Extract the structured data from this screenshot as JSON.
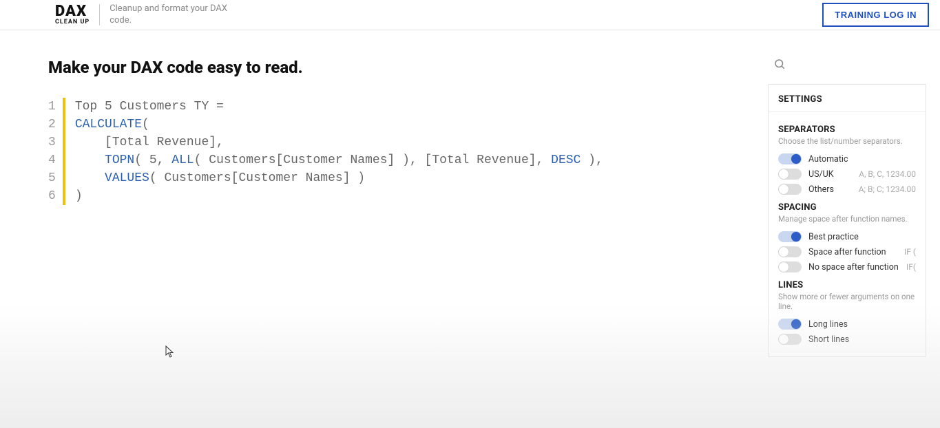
{
  "header": {
    "logo_main": "DAX",
    "logo_sub": "CLEAN UP",
    "tagline": "Cleanup and format your DAX code.",
    "login_label": "TRAINING LOG IN"
  },
  "page": {
    "heading": "Make your DAX code easy to read."
  },
  "code": {
    "line_numbers": [
      "1",
      "2",
      "3",
      "4",
      "5",
      "6"
    ],
    "lines": [
      [
        {
          "t": "Top 5 Customers TY ="
        }
      ],
      [
        {
          "t": "CALCULATE",
          "kw": true
        },
        {
          "t": "("
        }
      ],
      [
        {
          "t": "    [Total Revenue],"
        }
      ],
      [
        {
          "t": "    "
        },
        {
          "t": "TOPN",
          "kw": true
        },
        {
          "t": "( 5, "
        },
        {
          "t": "ALL",
          "kw": true
        },
        {
          "t": "( Customers[Customer Names] ), [Total Revenue], "
        },
        {
          "t": "DESC",
          "kw": true
        },
        {
          "t": " ),"
        }
      ],
      [
        {
          "t": "    "
        },
        {
          "t": "VALUES",
          "kw": true
        },
        {
          "t": "( Customers[Customer Names] )"
        }
      ],
      [
        {
          "t": ")"
        }
      ]
    ]
  },
  "settings": {
    "panel_title": "SETTINGS",
    "separators": {
      "title": "SEPARATORS",
      "desc": "Choose the list/number separators.",
      "options": [
        {
          "label": "Automatic",
          "on": true,
          "hint": ""
        },
        {
          "label": "US/UK",
          "on": false,
          "hint": "A, B, C, 1234.00"
        },
        {
          "label": "Others",
          "on": false,
          "hint": "A; B; C; 1234.00"
        }
      ]
    },
    "spacing": {
      "title": "SPACING",
      "desc": "Manage space after function names.",
      "options": [
        {
          "label": "Best practice",
          "on": true,
          "hint": ""
        },
        {
          "label": "Space after function",
          "on": false,
          "hint": "IF ("
        },
        {
          "label": "No space after function",
          "on": false,
          "hint": "IF("
        }
      ]
    },
    "lines": {
      "title": "LINES",
      "desc": "Show more or fewer arguments on one line.",
      "options": [
        {
          "label": "Long lines",
          "on": true,
          "hint": ""
        },
        {
          "label": "Short lines",
          "on": false,
          "hint": ""
        }
      ]
    }
  }
}
